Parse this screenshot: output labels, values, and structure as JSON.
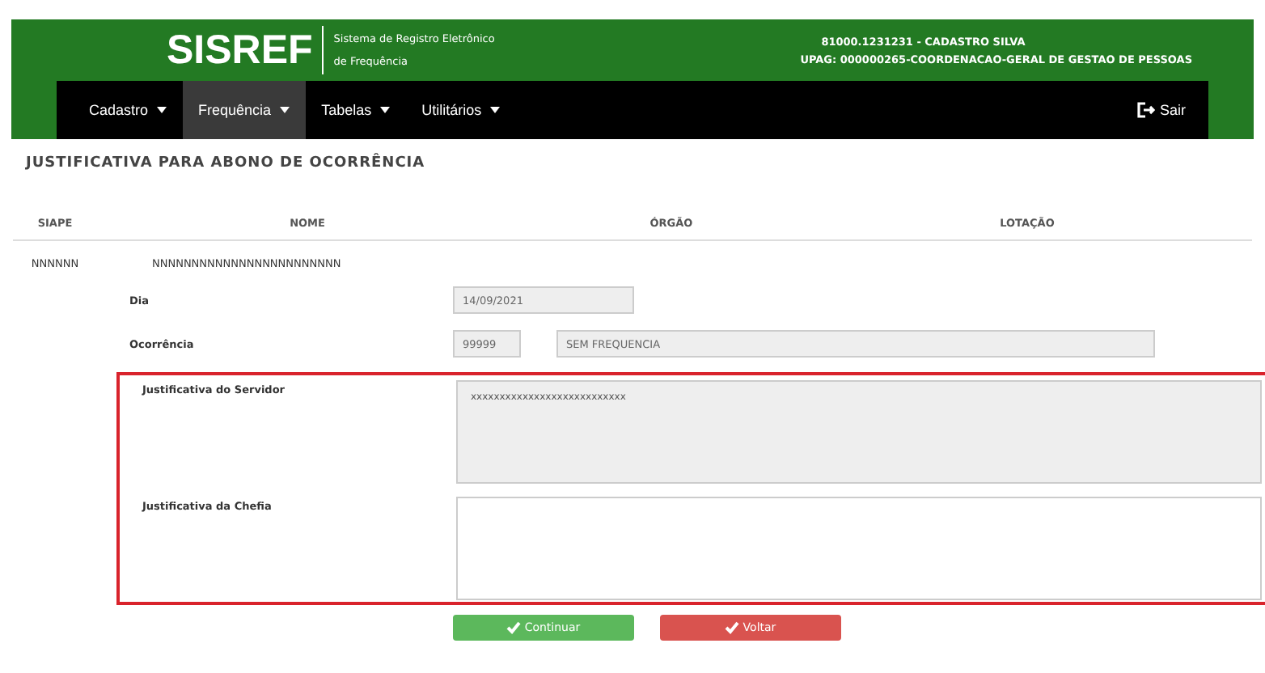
{
  "header": {
    "logo": "SISREF",
    "subtitle_lines": [
      "Sistema de Registro Eletrônico",
      "de Frequência"
    ],
    "user": "81000.1231231 - CADASTRO SILVA",
    "upag": "UPAG: 000000265-COORDENACAO-GERAL DE GESTAO DE PESSOAS"
  },
  "nav": {
    "items": [
      {
        "label": "Cadastro",
        "selected": false
      },
      {
        "label": "Frequência",
        "selected": true
      },
      {
        "label": "Tabelas",
        "selected": false
      },
      {
        "label": "Utilitários",
        "selected": false
      }
    ],
    "logout": "Sair"
  },
  "page_title": "JUSTIFICATIVA PARA ABONO DE OCORRÊNCIA",
  "table": {
    "columns": [
      "SIAPE",
      "NOME",
      "ÓRGÃO",
      "LOTAÇÃO"
    ],
    "rows": [
      [
        "NNNNNN",
        "NNNNNNNNNNNNNNNNNNNNNNNN"
      ]
    ]
  },
  "form": {
    "dia": {
      "label": "Dia",
      "value": "14/09/2021"
    },
    "ocorrencia": {
      "label": "Ocorrência",
      "code": "99999",
      "description": "SEM FREQUENCIA"
    },
    "justificativa_servidor": {
      "label": "Justificativa do Servidor",
      "value": "xxxxxxxxxxxxxxxxxxxxxxxxxxx",
      "disabled": true
    },
    "justificativa_chefia": {
      "label": "Justificativa da Chefia",
      "disabled": false
    }
  },
  "buttons": [
    {
      "label": "Continuar",
      "kind": "primary"
    },
    {
      "label": "Voltar",
      "kind": "danger"
    }
  ]
}
